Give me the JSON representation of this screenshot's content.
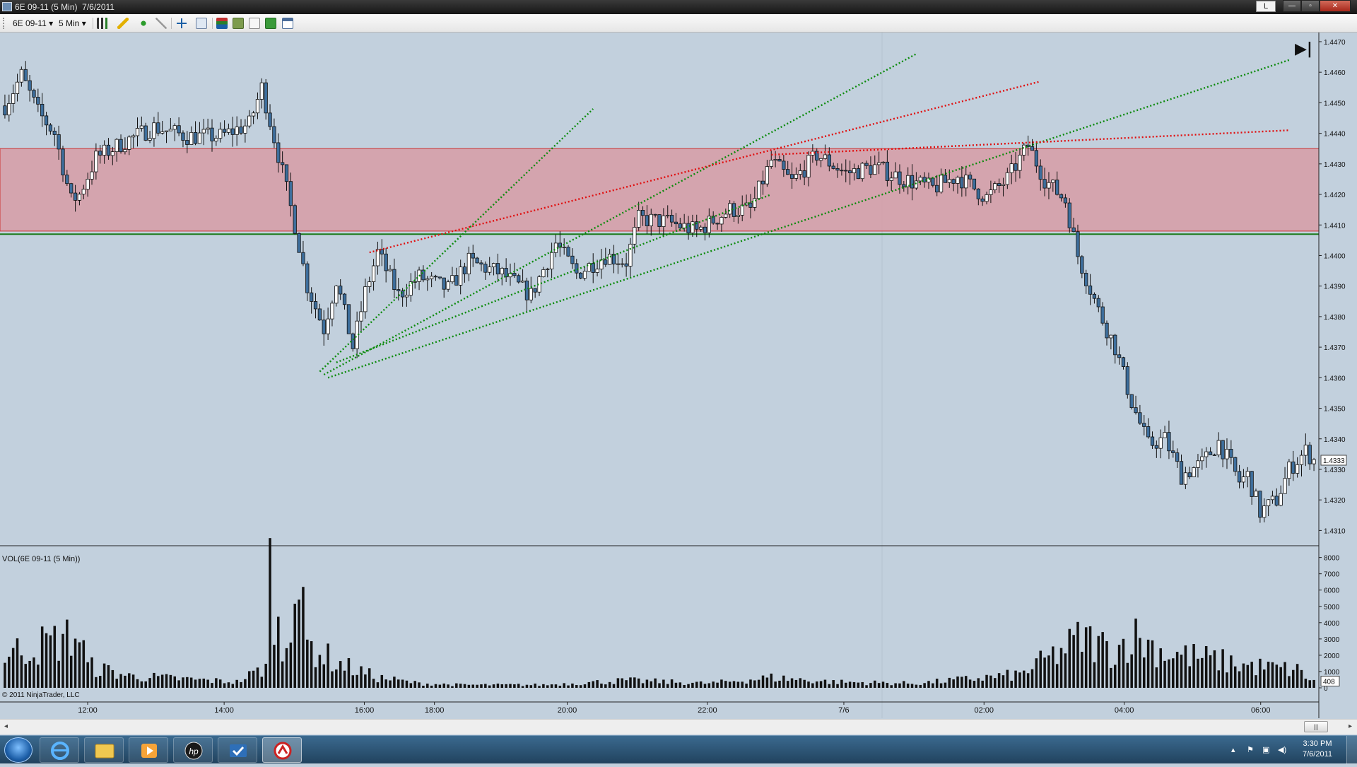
{
  "window": {
    "title": "6E 09-11 (5 Min)  7/6/2011",
    "l_button": "L",
    "minimize": "—",
    "maximize": "▫",
    "close": "✕"
  },
  "toolbar": {
    "instrument": "6E 09-11",
    "interval": "5 Min",
    "dropdown_glyph": "▾",
    "icons": [
      "bars-type-icon",
      "pencil-draw-icon",
      "add-indicator-icon",
      "strategy-icon",
      "crosshair-icon",
      "zoom-icon",
      "properties-icon",
      "data-box-icon",
      "chart-trader-icon",
      "order-icon",
      "window-icon"
    ]
  },
  "chart": {
    "copyright": "© 2011 NinjaTrader, LLC",
    "volume_label": "VOL(6E 09-11 (5 Min))",
    "last_price_label": "1.4333",
    "last_volume_label": "408",
    "goto_end_glyph": "▶|",
    "colors": {
      "background": "#c2d0dd",
      "up_candle": "#ffffff",
      "down_candle": "#3d6e9c",
      "zone_fill": "#d79ca6",
      "zone_border": "#cc3333",
      "support_line": "#1a7a1a",
      "trend_green": "#0b8a0b",
      "trend_red": "#e01010"
    }
  },
  "chart_data": {
    "type": "candlestick",
    "price_axis": {
      "ticks": [
        "1.4470",
        "1.4460",
        "1.4450",
        "1.4440",
        "1.4430",
        "1.4420",
        "1.4410",
        "1.4400",
        "1.4390",
        "1.4380",
        "1.4370",
        "1.4360",
        "1.4350",
        "1.4340",
        "1.4330",
        "1.4320",
        "1.4310"
      ],
      "range": [
        1.4305,
        1.4473
      ]
    },
    "time_axis": {
      "ticks": [
        "12:00",
        "14:00",
        "16:00",
        "18:00",
        "20:00",
        "22:00",
        "7/6",
        "02:00",
        "04:00",
        "06:00"
      ]
    },
    "volume_axis": {
      "ticks": [
        "8000",
        "7000",
        "6000",
        "5000",
        "4000",
        "3000",
        "2000",
        "1000",
        "0"
      ],
      "range": [
        0,
        8200
      ]
    },
    "zone": {
      "from": 1.4408,
      "to": 1.4435
    },
    "support_level": 1.4407,
    "last_price": 1.4333,
    "last_volume": 408,
    "anchors": [
      {
        "i": 0,
        "price": 1.4449
      },
      {
        "i": 4,
        "price": 1.4459
      },
      {
        "i": 8,
        "price": 1.4447
      },
      {
        "i": 12,
        "price": 1.444
      },
      {
        "i": 16,
        "price": 1.4418
      },
      {
        "i": 18,
        "price": 1.442
      },
      {
        "i": 22,
        "price": 1.4432
      },
      {
        "i": 30,
        "price": 1.4438
      },
      {
        "i": 36,
        "price": 1.4442
      },
      {
        "i": 44,
        "price": 1.4439
      },
      {
        "i": 52,
        "price": 1.4439
      },
      {
        "i": 59,
        "price": 1.4443
      },
      {
        "i": 62,
        "price": 1.4455
      },
      {
        "i": 66,
        "price": 1.4433
      },
      {
        "i": 70,
        "price": 1.441
      },
      {
        "i": 73,
        "price": 1.439
      },
      {
        "i": 77,
        "price": 1.4376
      },
      {
        "i": 80,
        "price": 1.4392
      },
      {
        "i": 84,
        "price": 1.437
      },
      {
        "i": 87,
        "price": 1.4388
      },
      {
        "i": 90,
        "price": 1.4401
      },
      {
        "i": 95,
        "price": 1.4387
      },
      {
        "i": 100,
        "price": 1.4393
      },
      {
        "i": 107,
        "price": 1.4389
      },
      {
        "i": 112,
        "price": 1.4398
      },
      {
        "i": 120,
        "price": 1.4394
      },
      {
        "i": 127,
        "price": 1.4387
      },
      {
        "i": 133,
        "price": 1.4404
      },
      {
        "i": 138,
        "price": 1.4394
      },
      {
        "i": 145,
        "price": 1.44
      },
      {
        "i": 150,
        "price": 1.4398
      },
      {
        "i": 153,
        "price": 1.4412
      },
      {
        "i": 160,
        "price": 1.4411
      },
      {
        "i": 167,
        "price": 1.4408
      },
      {
        "i": 175,
        "price": 1.4415
      },
      {
        "i": 180,
        "price": 1.4415
      },
      {
        "i": 185,
        "price": 1.4431
      },
      {
        "i": 190,
        "price": 1.4424
      },
      {
        "i": 196,
        "price": 1.4433
      },
      {
        "i": 203,
        "price": 1.4427
      },
      {
        "i": 210,
        "price": 1.4429
      },
      {
        "i": 217,
        "price": 1.4425
      },
      {
        "i": 224,
        "price": 1.4422
      },
      {
        "i": 230,
        "price": 1.4426
      },
      {
        "i": 237,
        "price": 1.4419
      },
      {
        "i": 242,
        "price": 1.4425
      },
      {
        "i": 247,
        "price": 1.4436
      },
      {
        "i": 251,
        "price": 1.4425
      },
      {
        "i": 256,
        "price": 1.4418
      },
      {
        "i": 259,
        "price": 1.44
      },
      {
        "i": 264,
        "price": 1.4382
      },
      {
        "i": 268,
        "price": 1.437
      },
      {
        "i": 272,
        "price": 1.4352
      },
      {
        "i": 276,
        "price": 1.4338
      },
      {
        "i": 280,
        "price": 1.434
      },
      {
        "i": 284,
        "price": 1.4328
      },
      {
        "i": 289,
        "price": 1.4332
      },
      {
        "i": 293,
        "price": 1.4339
      },
      {
        "i": 298,
        "price": 1.4326
      },
      {
        "i": 300,
        "price": 1.4328
      },
      {
        "i": 303,
        "price": 1.4316
      },
      {
        "i": 307,
        "price": 1.432
      },
      {
        "i": 310,
        "price": 1.433
      },
      {
        "i": 314,
        "price": 1.4336
      },
      {
        "i": 316,
        "price": 1.4333
      }
    ],
    "volume_profile": [
      {
        "i": 0,
        "v": 2300
      },
      {
        "i": 18,
        "v": 3600
      },
      {
        "i": 20,
        "v": 1500
      },
      {
        "i": 30,
        "v": 800
      },
      {
        "i": 56,
        "v": 400
      },
      {
        "i": 63,
        "v": 1400
      },
      {
        "i": 64,
        "v": 7800
      },
      {
        "i": 67,
        "v": 2000
      },
      {
        "i": 70,
        "v": 7900
      },
      {
        "i": 73,
        "v": 3000
      },
      {
        "i": 80,
        "v": 1700
      },
      {
        "i": 90,
        "v": 700
      },
      {
        "i": 100,
        "v": 300
      },
      {
        "i": 110,
        "v": 200
      },
      {
        "i": 130,
        "v": 200
      },
      {
        "i": 150,
        "v": 500
      },
      {
        "i": 170,
        "v": 300
      },
      {
        "i": 185,
        "v": 700
      },
      {
        "i": 200,
        "v": 400
      },
      {
        "i": 220,
        "v": 300
      },
      {
        "i": 245,
        "v": 900
      },
      {
        "i": 255,
        "v": 2500
      },
      {
        "i": 260,
        "v": 3400
      },
      {
        "i": 268,
        "v": 2500
      },
      {
        "i": 272,
        "v": 3600
      },
      {
        "i": 280,
        "v": 2400
      },
      {
        "i": 290,
        "v": 2000
      },
      {
        "i": 300,
        "v": 1500
      },
      {
        "i": 312,
        "v": 1200
      },
      {
        "i": 316,
        "v": 408
      }
    ],
    "trendlines": [
      {
        "color": "green",
        "from": {
          "i": 76,
          "price": 1.4362
        },
        "to": {
          "i": 142,
          "price": 1.4448
        }
      },
      {
        "color": "green",
        "from": {
          "i": 77,
          "price": 1.4361
        },
        "to": {
          "i": 220,
          "price": 1.4466
        }
      },
      {
        "color": "green",
        "from": {
          "i": 78,
          "price": 1.436
        },
        "to": {
          "i": 310,
          "price": 1.4464
        }
      },
      {
        "color": "green",
        "from": {
          "i": 80,
          "price": 1.4365
        },
        "to": {
          "i": 185,
          "price": 1.442
        }
      },
      {
        "color": "red",
        "from": {
          "i": 88,
          "price": 1.4401
        },
        "to": {
          "i": 250,
          "price": 1.4457
        }
      },
      {
        "color": "red",
        "from": {
          "i": 185,
          "price": 1.4433
        },
        "to": {
          "i": 310,
          "price": 1.4441
        }
      }
    ],
    "bar_count": 317
  },
  "taskbar": {
    "apps": [
      "internet-explorer",
      "windows-explorer",
      "media-player",
      "hp-utility",
      "task-app",
      "ninjatrader"
    ],
    "time": "3:30 PM",
    "date": "7/6/2011"
  }
}
